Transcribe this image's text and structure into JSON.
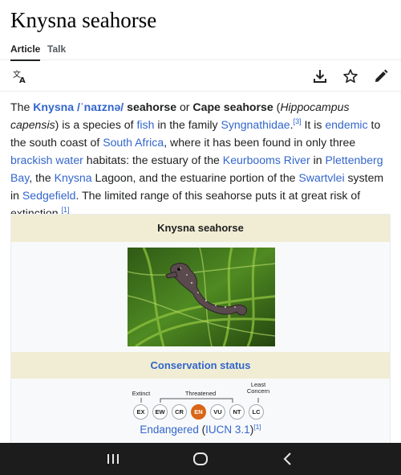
{
  "page": {
    "title": "Knysna seahorse"
  },
  "tabs": {
    "article": "Article",
    "talk": "Talk"
  },
  "toolbar": {
    "icons": [
      "language-icon",
      "download-icon",
      "star-icon",
      "edit-icon"
    ]
  },
  "intro": {
    "t1": "The ",
    "name": "Knysna",
    "ipa": "/ˈnaɪznə/",
    "t2": " seahorse",
    "t3": " or ",
    "alt_name": "Cape seahorse",
    "t4": " (",
    "binomial": "Hippocampus capensis",
    "t5": ") is a species of ",
    "fish": "fish",
    "t6": " in the family ",
    "family": "Syngnathidae",
    "t7": ".",
    "ref3": "[3]",
    "t8": " It is ",
    "endemic": "endemic",
    "t9": " to the south coast of ",
    "south_africa": "South Africa",
    "t10": ", where it has been found in only three ",
    "brackish": "brackish water",
    "t11": " habitats: the estuary of the ",
    "keurbooms": "Keurbooms River",
    "t12": " in ",
    "plettenberg": "Plettenberg Bay",
    "t13": ", the ",
    "knysna_lagoon": "Knysna",
    "t14": " Lagoon, and the estuarine portion of the ",
    "swartvlei": "Swartvlei",
    "t15": " system in ",
    "sedgefield": "Sedgefield",
    "t16": ". The limited range of this seahorse puts it at great risk of extinction.",
    "ref1": "[1]"
  },
  "infobox": {
    "title": "Knysna seahorse",
    "status_heading": "Conservation status",
    "scale_labels": {
      "extinct": "Extinct",
      "threatened": "Threatened",
      "least": "Least",
      "concern": "Concern"
    },
    "scale": [
      "EX",
      "EW",
      "CR",
      "EN",
      "VU",
      "NT",
      "LC"
    ],
    "selected_status": "EN",
    "status_text": "Endangered",
    "status_paren_open": " (",
    "status_source": "IUCN 3.1",
    "status_paren_close": ")",
    "status_ref": "[1]",
    "colors": {
      "header_bg": "#f0edd4",
      "selected": "#d86616"
    }
  },
  "navbar": {
    "icons": [
      "recent-apps-icon",
      "home-icon",
      "back-icon"
    ]
  }
}
